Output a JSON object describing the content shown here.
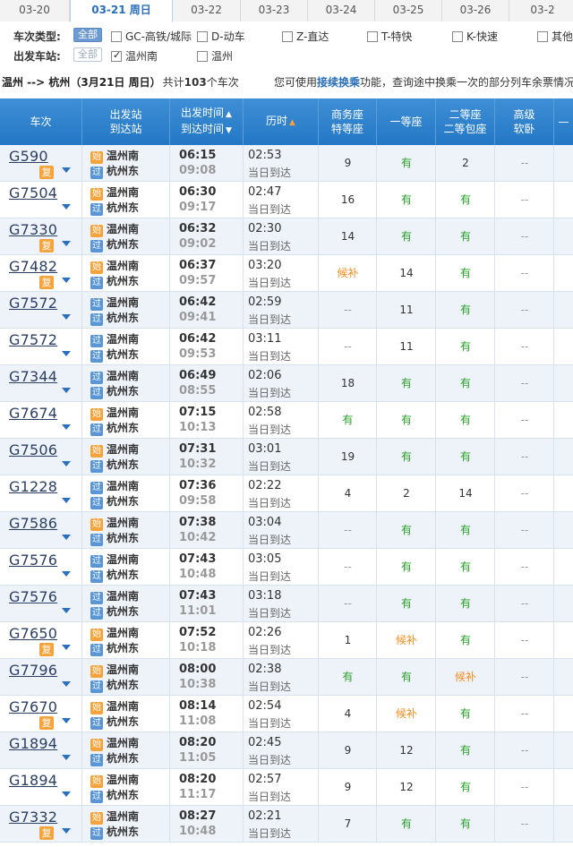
{
  "date_tabs": [
    {
      "label": "03-20",
      "active": false
    },
    {
      "label": "03-21  周日",
      "active": true
    },
    {
      "label": "03-22",
      "active": false
    },
    {
      "label": "03-23",
      "active": false
    },
    {
      "label": "03-24",
      "active": false
    },
    {
      "label": "03-25",
      "active": false
    },
    {
      "label": "03-26",
      "active": false
    },
    {
      "label": "03-2",
      "active": false
    }
  ],
  "filters": {
    "type_label": "车次类型:",
    "type_all": "全部",
    "type_options": [
      "GC-高铁/城际",
      "D-动车",
      "Z-直达",
      "T-特快",
      "K-快速",
      "其他"
    ],
    "station_label": "出发车站:",
    "station_all": "全部",
    "station_options": [
      {
        "label": "温州南",
        "checked": true
      },
      {
        "label": "温州",
        "checked": false
      }
    ]
  },
  "summary": {
    "route": "温州 --> 杭州（3月21日  周日）",
    "count_prefix": "共计",
    "count": "103",
    "count_suffix": "个车次",
    "tip_prefix": "您可使用",
    "tip_link": "接续换乘",
    "tip_suffix": "功能，查询途中换乘一次的部分列车余票情况。"
  },
  "header": {
    "train": "车次",
    "station_top": "出发站",
    "station_bot": "到达站",
    "time_top": "出发时间",
    "time_bot": "到达时间",
    "duration": "历时",
    "biz_top": "商务座",
    "biz_bot": "特等座",
    "first": "一等座",
    "second_top": "二等座",
    "second_bot": "二等包座",
    "soft_top": "高级",
    "soft_bot": "软卧",
    "more": "—"
  },
  "labels": {
    "fu": "复",
    "shi": "始",
    "guo": "过",
    "arr_same_day": "当日到达"
  },
  "rows": [
    {
      "no": "G590",
      "fu": true,
      "from": "温州南",
      "from_badge": "始",
      "to": "杭州东",
      "to_badge": "过",
      "dep": "06:15",
      "arr": "09:08",
      "dur": "02:53",
      "biz": "9",
      "first": "有",
      "second": "2",
      "soft": "--"
    },
    {
      "no": "G7504",
      "fu": false,
      "from": "温州南",
      "from_badge": "始",
      "to": "杭州东",
      "to_badge": "过",
      "dep": "06:30",
      "arr": "09:17",
      "dur": "02:47",
      "biz": "16",
      "first": "有",
      "second": "有",
      "soft": "--"
    },
    {
      "no": "G7330",
      "fu": true,
      "from": "温州南",
      "from_badge": "始",
      "to": "杭州东",
      "to_badge": "过",
      "dep": "06:32",
      "arr": "09:02",
      "dur": "02:30",
      "biz": "14",
      "first": "有",
      "second": "有",
      "soft": "--"
    },
    {
      "no": "G7482",
      "fu": true,
      "from": "温州南",
      "from_badge": "始",
      "to": "杭州东",
      "to_badge": "过",
      "dep": "06:37",
      "arr": "09:57",
      "dur": "03:20",
      "biz": "候补",
      "first": "14",
      "second": "有",
      "soft": "--"
    },
    {
      "no": "G7572",
      "fu": false,
      "from": "温州南",
      "from_badge": "过",
      "to": "杭州东",
      "to_badge": "过",
      "dep": "06:42",
      "arr": "09:41",
      "dur": "02:59",
      "biz": "--",
      "first": "11",
      "second": "有",
      "soft": "--"
    },
    {
      "no": "G7572",
      "fu": false,
      "from": "温州南",
      "from_badge": "过",
      "to": "杭州东",
      "to_badge": "过",
      "dep": "06:42",
      "arr": "09:53",
      "dur": "03:11",
      "biz": "--",
      "first": "11",
      "second": "有",
      "soft": "--"
    },
    {
      "no": "G7344",
      "fu": false,
      "from": "温州南",
      "from_badge": "过",
      "to": "杭州东",
      "to_badge": "过",
      "dep": "06:49",
      "arr": "08:55",
      "dur": "02:06",
      "biz": "18",
      "first": "有",
      "second": "有",
      "soft": "--"
    },
    {
      "no": "G7674",
      "fu": false,
      "from": "温州南",
      "from_badge": "始",
      "to": "杭州东",
      "to_badge": "过",
      "dep": "07:15",
      "arr": "10:13",
      "dur": "02:58",
      "biz": "有",
      "first": "有",
      "second": "有",
      "soft": "--"
    },
    {
      "no": "G7506",
      "fu": false,
      "from": "温州南",
      "from_badge": "始",
      "to": "杭州东",
      "to_badge": "过",
      "dep": "07:31",
      "arr": "10:32",
      "dur": "03:01",
      "biz": "19",
      "first": "有",
      "second": "有",
      "soft": "--"
    },
    {
      "no": "G1228",
      "fu": false,
      "from": "温州南",
      "from_badge": "过",
      "to": "杭州东",
      "to_badge": "过",
      "dep": "07:36",
      "arr": "09:58",
      "dur": "02:22",
      "biz": "4",
      "first": "2",
      "second": "14",
      "soft": "--"
    },
    {
      "no": "G7586",
      "fu": false,
      "from": "温州南",
      "from_badge": "始",
      "to": "杭州东",
      "to_badge": "过",
      "dep": "07:38",
      "arr": "10:42",
      "dur": "03:04",
      "biz": "--",
      "first": "有",
      "second": "有",
      "soft": "--"
    },
    {
      "no": "G7576",
      "fu": false,
      "from": "温州南",
      "from_badge": "过",
      "to": "杭州东",
      "to_badge": "过",
      "dep": "07:43",
      "arr": "10:48",
      "dur": "03:05",
      "biz": "--",
      "first": "有",
      "second": "有",
      "soft": "--"
    },
    {
      "no": "G7576",
      "fu": false,
      "from": "温州南",
      "from_badge": "过",
      "to": "杭州东",
      "to_badge": "过",
      "dep": "07:43",
      "arr": "11:01",
      "dur": "03:18",
      "biz": "--",
      "first": "有",
      "second": "有",
      "soft": "--"
    },
    {
      "no": "G7650",
      "fu": true,
      "from": "温州南",
      "from_badge": "始",
      "to": "杭州东",
      "to_badge": "过",
      "dep": "07:52",
      "arr": "10:18",
      "dur": "02:26",
      "biz": "1",
      "first": "候补",
      "second": "有",
      "soft": "--"
    },
    {
      "no": "G7796",
      "fu": false,
      "from": "温州南",
      "from_badge": "始",
      "to": "杭州东",
      "to_badge": "过",
      "dep": "08:00",
      "arr": "10:38",
      "dur": "02:38",
      "biz": "有",
      "first": "有",
      "second": "候补",
      "soft": "--"
    },
    {
      "no": "G7670",
      "fu": true,
      "from": "温州南",
      "from_badge": "始",
      "to": "杭州东",
      "to_badge": "过",
      "dep": "08:14",
      "arr": "11:08",
      "dur": "02:54",
      "biz": "4",
      "first": "候补",
      "second": "有",
      "soft": "--"
    },
    {
      "no": "G1894",
      "fu": false,
      "from": "温州南",
      "from_badge": "始",
      "to": "杭州东",
      "to_badge": "过",
      "dep": "08:20",
      "arr": "11:05",
      "dur": "02:45",
      "biz": "9",
      "first": "12",
      "second": "有",
      "soft": "--"
    },
    {
      "no": "G1894",
      "fu": false,
      "from": "温州南",
      "from_badge": "始",
      "to": "杭州东",
      "to_badge": "过",
      "dep": "08:20",
      "arr": "11:17",
      "dur": "02:57",
      "biz": "9",
      "first": "12",
      "second": "有",
      "soft": "--"
    },
    {
      "no": "G7332",
      "fu": true,
      "from": "温州南",
      "from_badge": "始",
      "to": "杭州东",
      "to_badge": "过",
      "dep": "08:27",
      "arr": "10:48",
      "dur": "02:21",
      "biz": "7",
      "first": "有",
      "second": "有",
      "soft": "--"
    }
  ]
}
